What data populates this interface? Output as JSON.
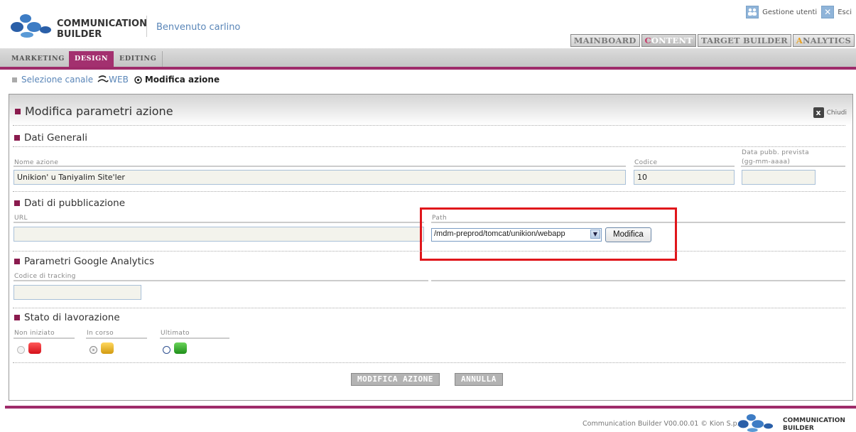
{
  "header": {
    "logo_line1": "COMMUNICATION",
    "logo_line2": "BUILDER",
    "welcome": "Benvenuto carlino",
    "user_management": "Gestione utenti",
    "exit": "Esci"
  },
  "main_tabs": [
    {
      "label_rest": "MAINBOARD",
      "active": false
    },
    {
      "first_letter": "C",
      "label_rest": "ONTENT",
      "active": true
    },
    {
      "label_rest": "TARGET BUILDER",
      "active": false
    },
    {
      "first_letter": "A",
      "label_rest": "NALYTICS",
      "active": false
    }
  ],
  "sub_tabs": [
    {
      "label": "MARKETING",
      "active": false
    },
    {
      "label": "DESIGN",
      "active": true
    },
    {
      "label": "EDITING",
      "active": false
    }
  ],
  "breadcrumb": {
    "channel": "Selezione canale",
    "web": "WEB",
    "current": "Modifica azione"
  },
  "panel": {
    "title": "Modifica parametri azione",
    "close": "Chiudi"
  },
  "general": {
    "title": "Dati Generali",
    "name_label": "Nome azione",
    "name_value": "Unikion' u Taniyalim Site'ler",
    "code_label": "Codice",
    "code_value": "10",
    "date_label_1": "Data pubb. prevista",
    "date_label_2": "(gg-mm-aaaa)",
    "date_value": ""
  },
  "publication": {
    "title": "Dati di pubblicazione",
    "url_label": "URL",
    "url_value": "",
    "path_label": "Path",
    "path_value": "/mdm-preprod/tomcat/unikion/webapp",
    "modify_button": "Modifica"
  },
  "analytics": {
    "title": "Parametri Google Analytics",
    "tracking_label": "Codice di tracking",
    "tracking_value": ""
  },
  "status": {
    "title": "Stato di lavorazione",
    "options": [
      {
        "label": "Non iniziato",
        "color": "#e8202a"
      },
      {
        "label": "In corso",
        "color": "#e0b020"
      },
      {
        "label": "Ultimato",
        "color": "#2fa32a"
      }
    ]
  },
  "actions": {
    "submit": "MODIFICA AZIONE",
    "cancel": "ANNULLA"
  },
  "footer": {
    "text": "Communication Builder V00.00.01 © Kion S.p.A.",
    "logo_line1": "COMMUNICATION",
    "logo_line2": "BUILDER"
  },
  "colors": {
    "accent": "#9e2b6a",
    "link": "#5a86b8",
    "highlight": "#e0161b"
  }
}
